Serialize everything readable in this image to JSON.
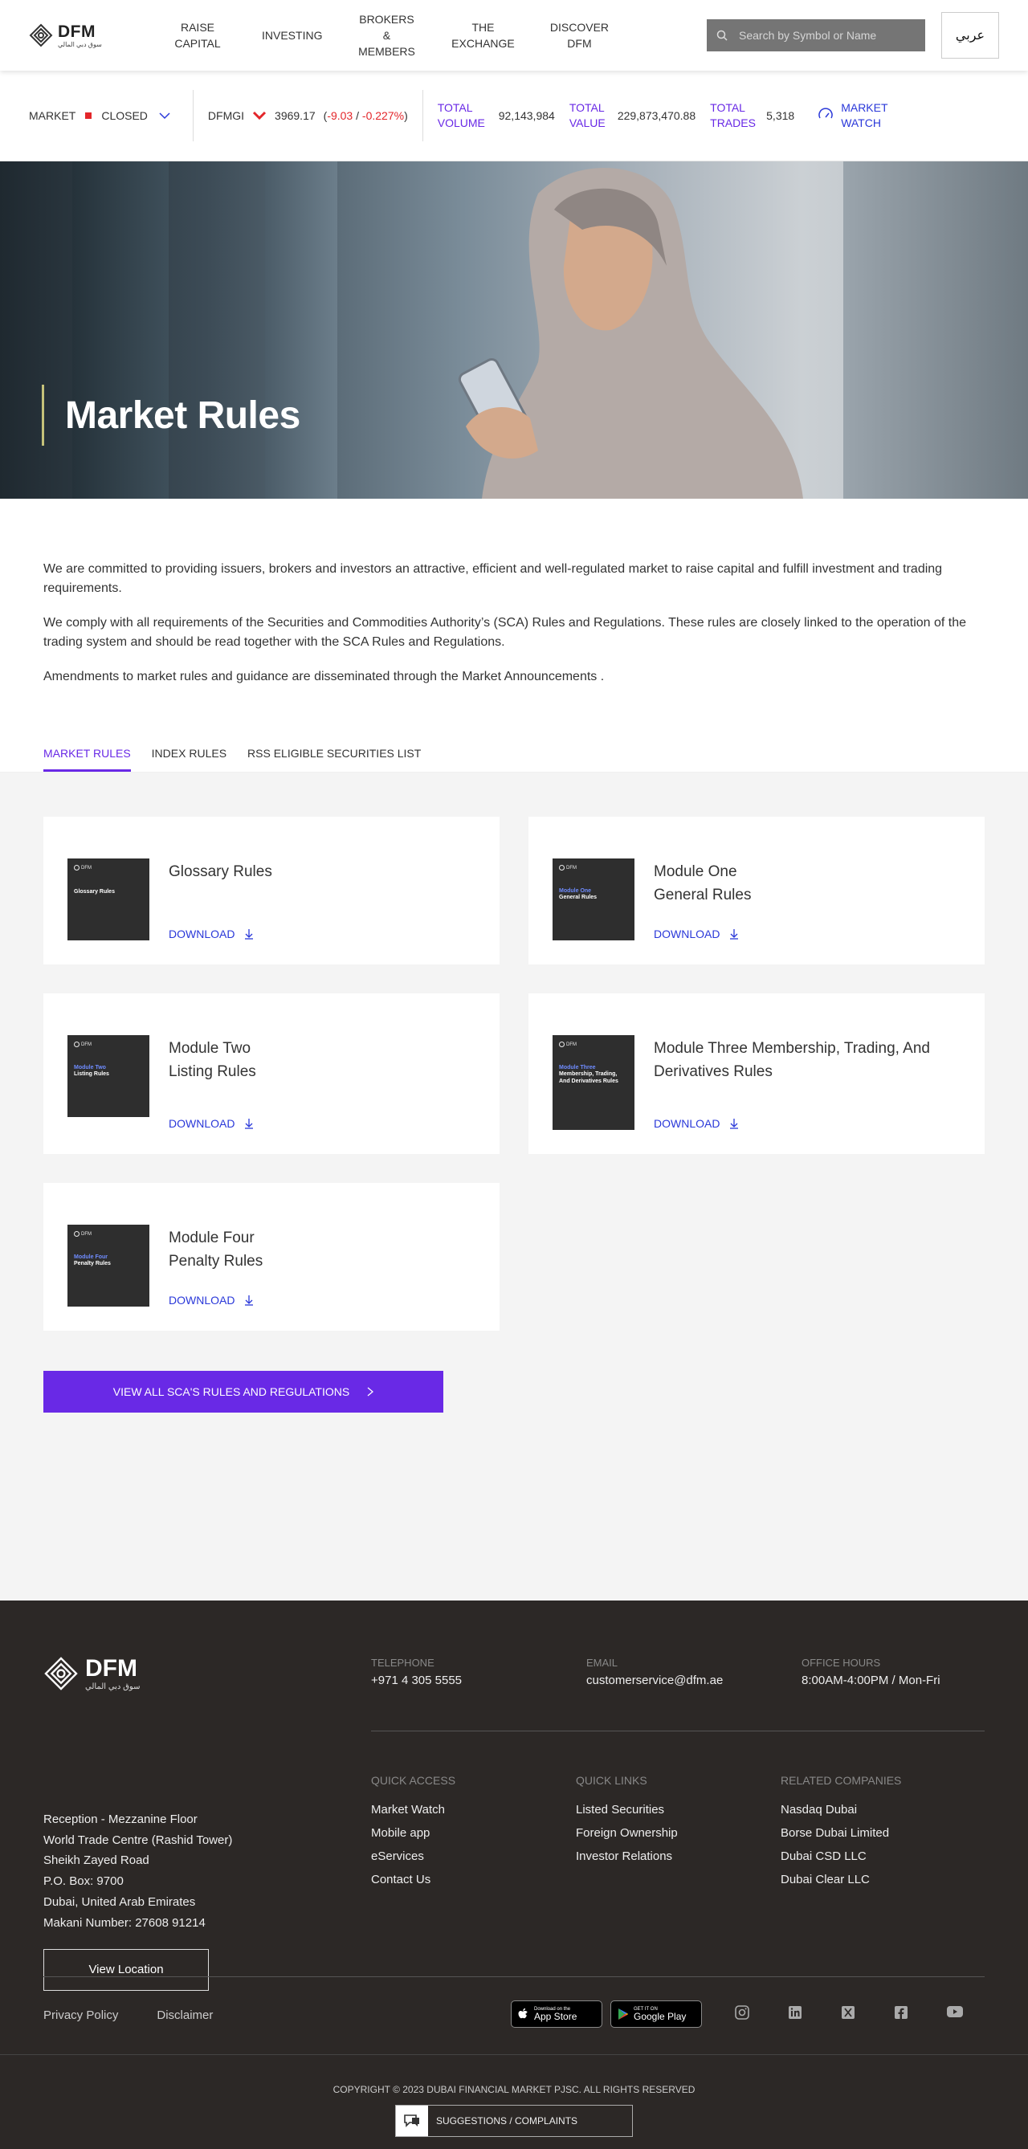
{
  "header": {
    "logo_text": "DFM",
    "logo_sub": "سوق دبي المالي",
    "nav": [
      {
        "label": "RAISE CAPITAL"
      },
      {
        "label": "INVESTING"
      },
      {
        "label": "BROKERS & MEMBERS"
      },
      {
        "label": "THE EXCHANGE"
      },
      {
        "label": "DISCOVER DFM"
      }
    ],
    "search_placeholder": "Search by Symbol or Name",
    "lang_label": "عربي"
  },
  "ticker": {
    "market_label": "MARKET",
    "market_status": "CLOSED",
    "index_name": "DFMGI",
    "index_value": "3969.17",
    "change_value": "-9.03",
    "change_percent": "-0.227%",
    "volume_label": "TOTAL VOLUME",
    "volume_value": "92,143,984",
    "value_label": "TOTAL VALUE",
    "value_value": "229,873,470.88",
    "trades_label": "TOTAL TRADES",
    "trades_value": "5,318",
    "watch_label": "MARKET WATCH",
    "colors": {
      "negative": "#e3262a",
      "accent": "#6929e6",
      "link": "#2a38d9"
    }
  },
  "hero": {
    "title": "Market Rules"
  },
  "intro": {
    "p1": "We are committed to providing issuers, brokers and investors an attractive, efficient and well-regulated market to raise capital and fulfill investment and trading requirements.",
    "p2": "We comply with all requirements of the Securities and Commodities Authority’s (SCA) Rules and Regulations. These rules are closely linked to the operation of the trading system and should be read together with the SCA Rules and Regulations.",
    "p3": "Amendments to market rules and guidance are disseminated through the Market Announcements ."
  },
  "tabs": [
    {
      "label": "MARKET RULES",
      "active": true
    },
    {
      "label": "INDEX RULES",
      "active": false
    },
    {
      "label": "RSS ELIGIBLE SECURITIES LIST",
      "active": false
    }
  ],
  "cards": [
    {
      "title": "Glossary Rules",
      "thumb_module": "",
      "thumb_name": "Glossary Rules",
      "download": "DOWNLOAD"
    },
    {
      "title": "Module One General Rules",
      "thumb_module": "Module One",
      "thumb_name": "General Rules",
      "download": "DOWNLOAD"
    },
    {
      "title": "Module Two Listing Rules",
      "thumb_module": "Module Two",
      "thumb_name": "Listing Rules",
      "download": "DOWNLOAD"
    },
    {
      "title": "Module Three Membership, Trading, And Derivatives Rules",
      "thumb_module": "Module Three",
      "thumb_name": "Membership, Trading, And Derivatives Rules",
      "download": "DOWNLOAD"
    },
    {
      "title": "Module Four Penalty Rules",
      "thumb_module": "Module Four",
      "thumb_name": "Penalty Rules",
      "download": "DOWNLOAD"
    }
  ],
  "view_all_label": "VIEW ALL SCA'S RULES AND REGULATIONS",
  "footer": {
    "address": [
      "Reception - Mezzanine Floor",
      "World Trade Centre (Rashid Tower)",
      "Sheikh Zayed Road",
      "P.O. Box: 9700",
      "Dubai, United Arab Emirates",
      "Makani Number: 27608 91214"
    ],
    "view_location": "View Location",
    "telephone_label": "TELEPHONE",
    "telephone_value": "+971 4 305 5555",
    "email_label": "EMAIL",
    "email_value": "customerservice@dfm.ae",
    "hours_label": "OFFICE HOURS",
    "hours_value": "8:00AM-4:00PM / Mon-Fri",
    "quick_access": {
      "title": "QUICK ACCESS",
      "items": [
        "Market Watch",
        "Mobile app",
        "eServices",
        "Contact Us"
      ]
    },
    "quick_links": {
      "title": "QUICK LINKS",
      "items": [
        "Listed Securities",
        "Foreign Ownership",
        "Investor Relations"
      ]
    },
    "related": {
      "title": "RELATED COMPANIES",
      "items": [
        "Nasdaq Dubai",
        "Borse Dubai Limited",
        "Dubai CSD LLC",
        "Dubai Clear LLC"
      ]
    },
    "privacy": "Privacy Policy",
    "disclaimer": "Disclaimer",
    "app_store_small": "Download on the",
    "app_store_big": "App Store",
    "google_small": "GET IT ON",
    "google_big": "Google Play",
    "copyright": "COPYRIGHT © 2023 DUBAI FINANCIAL MARKET PJSC. ALL RIGHTS RESERVED",
    "suggestions": "SUGGESTIONS / COMPLAINTS"
  }
}
